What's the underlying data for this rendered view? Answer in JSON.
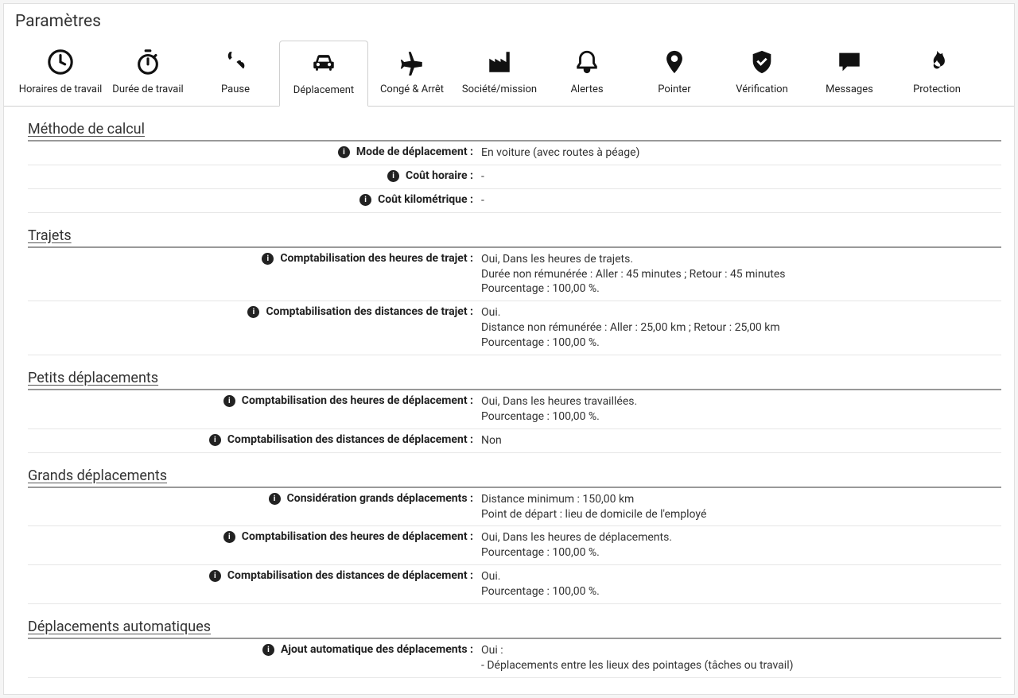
{
  "page": {
    "title": "Paramètres"
  },
  "tabs": [
    {
      "label": "Horaires de travail",
      "icon": "clock"
    },
    {
      "label": "Durée de travail",
      "icon": "stopwatch"
    },
    {
      "label": "Pause",
      "icon": "utensils"
    },
    {
      "label": "Déplacement",
      "icon": "car",
      "active": true
    },
    {
      "label": "Congé & Arrêt",
      "icon": "plane"
    },
    {
      "label": "Société/mission",
      "icon": "factory"
    },
    {
      "label": "Alertes",
      "icon": "bell"
    },
    {
      "label": "Pointer",
      "icon": "pin"
    },
    {
      "label": "Vérification",
      "icon": "shield"
    },
    {
      "label": "Messages",
      "icon": "message"
    },
    {
      "label": "Protection",
      "icon": "flame"
    }
  ],
  "sections": [
    {
      "title": "Méthode de calcul",
      "rows": [
        {
          "label": "Mode de déplacement :",
          "value": "En voiture (avec routes à péage)"
        },
        {
          "label": "Coût horaire :",
          "value": "-"
        },
        {
          "label": "Coût kilométrique :",
          "value": "-"
        }
      ]
    },
    {
      "title": "Trajets",
      "rows": [
        {
          "label": "Comptabilisation des heures de trajet :",
          "value": "Oui, Dans les heures de trajets.\nDurée non rémunérée : Aller : 45 minutes ; Retour : 45 minutes\nPourcentage : 100,00 %."
        },
        {
          "label": "Comptabilisation des distances de trajet :",
          "value": "Oui.\nDistance non rémunérée : Aller : 25,00 km ; Retour : 25,00 km\nPourcentage : 100,00 %."
        }
      ]
    },
    {
      "title": "Petits déplacements",
      "rows": [
        {
          "label": "Comptabilisation des heures de déplacement :",
          "value": "Oui, Dans les heures travaillées.\nPourcentage : 100,00 %."
        },
        {
          "label": "Comptabilisation des distances de déplacement :",
          "value": "Non"
        }
      ]
    },
    {
      "title": "Grands déplacements",
      "rows": [
        {
          "label": "Considération grands déplacements :",
          "value": "Distance minimum : 150,00 km\nPoint de départ : lieu de domicile de l'employé"
        },
        {
          "label": "Comptabilisation des heures de déplacement :",
          "value": "Oui, Dans les heures de déplacements.\nPourcentage : 100,00 %."
        },
        {
          "label": "Comptabilisation des distances de déplacement :",
          "value": "Oui.\nPourcentage : 100,00 %."
        }
      ]
    },
    {
      "title": "Déplacements automatiques",
      "rows": [
        {
          "label": "Ajout automatique des déplacements :",
          "value": "Oui :\n- Déplacements entre les lieux des pointages (tâches ou travail)"
        }
      ]
    }
  ]
}
